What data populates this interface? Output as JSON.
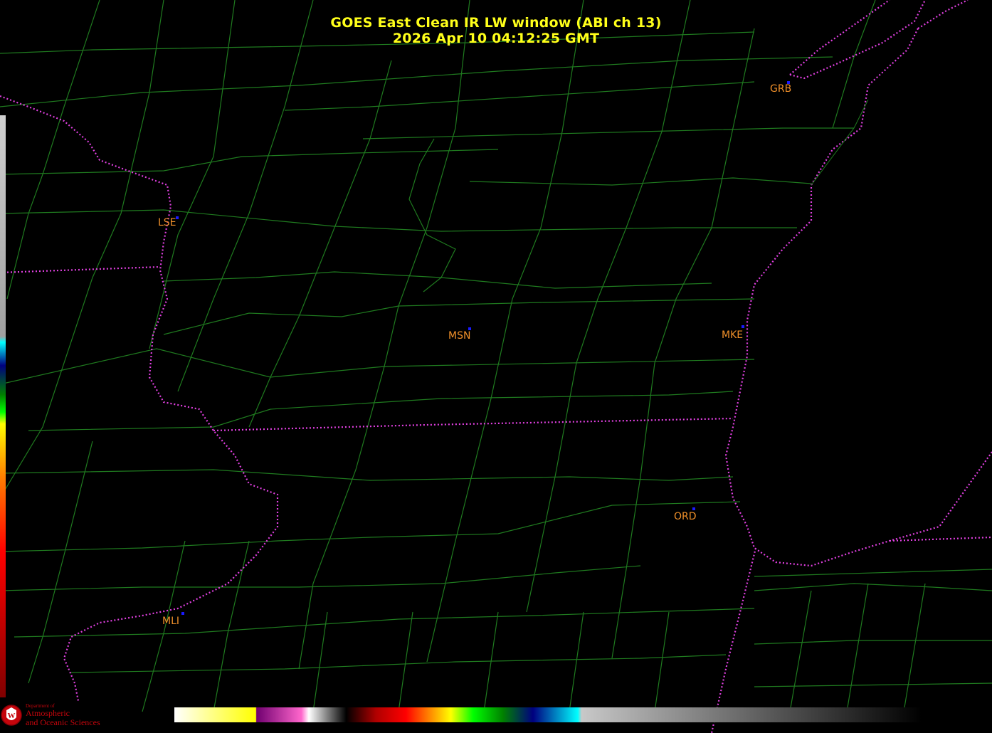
{
  "header": {
    "title": "GOES East Clean IR LW window (ABI ch 13)",
    "timestamp": "2026 Apr 10  04:12:25 GMT"
  },
  "colors": {
    "background": "#000000",
    "county_lines": "#1f7a1f",
    "state_lines": "#e040e0",
    "title_text": "#ffff1a",
    "city_label": "#f0902a",
    "city_marker": "#1a1aff"
  },
  "map": {
    "cities": [
      {
        "code": "GRB"
      },
      {
        "code": "LSE"
      },
      {
        "code": "MSN"
      },
      {
        "code": "MKE"
      },
      {
        "code": "ORD"
      },
      {
        "code": "MLI"
      }
    ]
  },
  "colorbar": {
    "stops": [
      "#ffffff",
      "#ffff66",
      "#ffff00",
      "#800080",
      "#ff66cc",
      "#ffffff",
      "#000000",
      "#ff0000",
      "#ff8000",
      "#ffff00",
      "#00ff00",
      "#008000",
      "#000080",
      "#00ffff",
      "#c0c0c0",
      "#000000"
    ]
  },
  "logo": {
    "department": "Department of",
    "line1": "Atmospheric",
    "line2": "and Oceanic Sciences",
    "emblem_letter": "W"
  }
}
